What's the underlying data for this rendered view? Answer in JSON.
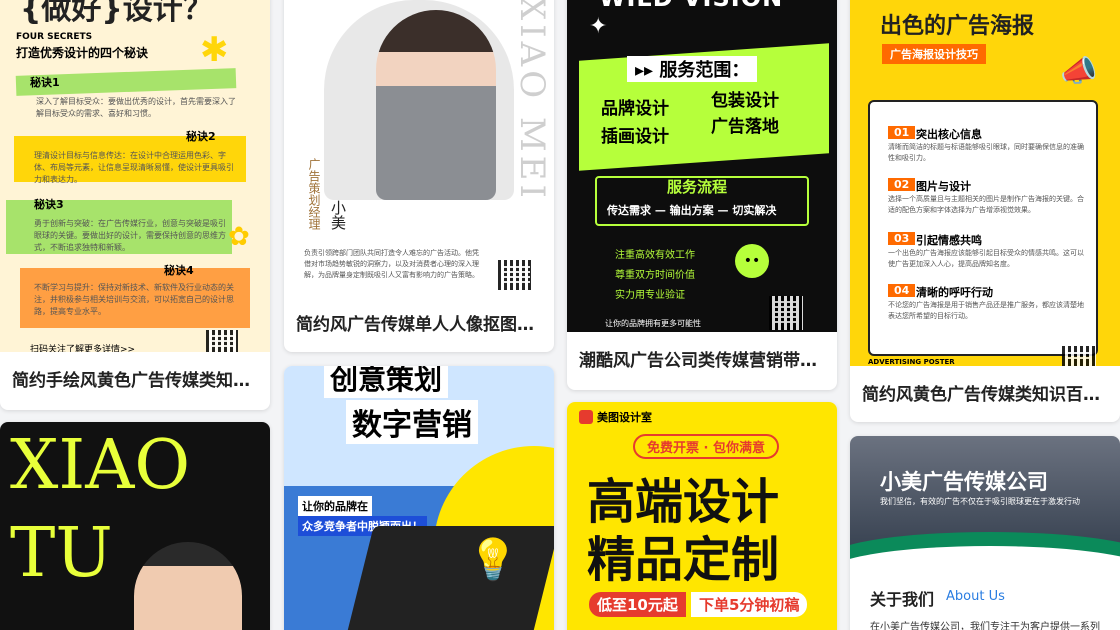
{
  "colors": {
    "yellow": "#ffd60a",
    "lime": "#b6ff3b",
    "orange": "#ff8a00",
    "green": "#0b8a5a",
    "blue": "#2a7de1"
  },
  "cards": {
    "c1": {
      "caption": "简约手绘风黄色广告传媒类知识百科小红书配图",
      "head": "{做好}设计？",
      "eng": "FOUR SECRETS",
      "sub": "打造优秀设计的四个秘诀",
      "tips": [
        {
          "label": "秘诀1",
          "text": "深入了解目标受众：要做出优秀的设计，首先需要深入了解目标受众的需求、喜好和习惯。"
        },
        {
          "label": "秘诀2",
          "text": "理清设计目标与信息传达：在设计中合理运用色彩、字体、布局等元素，让信息呈现清晰易懂，使设计更具吸引力和表达力。"
        },
        {
          "label": "秘诀3",
          "text": "勇于创新与突破：在广告传媒行业，创意与突破是吸引眼球的关键。要做出好的设计，需要保持创意的思维方式，不断追求独特和新颖。"
        },
        {
          "label": "秘诀4",
          "text": "不断学习与提升：保持对新技术、新软件及行业动态的关注，并积极参与相关培训与交流，可以拓宽自己的设计思路，提高专业水平。"
        }
      ],
      "footer": "扫码关注了解更多详情>>"
    },
    "c2": {
      "caption": "简约风广告传媒单人人像抠图海报",
      "vertical": "XIAO MEI",
      "role": "广告策划经理",
      "name": "小美",
      "bio": "负责引领跨部门团队共同打造令人难忘的广告活动。他凭借对市场趋势敏锐的洞察力，以及对消费者心理的深入理解，为品牌量身定制既吸引人又富有影响力的广告策略。"
    },
    "c3": {
      "caption": "潮酷风广告公司类传媒营销带货小红书配图",
      "head": "WILD VISION",
      "scope_title": "服务范围：",
      "services": [
        "品牌设计",
        "包装设计",
        "插画设计",
        "广告落地"
      ],
      "flow_title": "服务流程",
      "flow": "传达需求 — 输出方案 — 切实解决",
      "bullets": [
        "注重高效有效工作",
        "尊重双方时间价值",
        "实力用专业验证"
      ],
      "footer": "让你的品牌拥有更多可能性"
    },
    "c4": {
      "caption": "简约风黄色广告传媒类知识百科小红书配图",
      "head": "出色的广告海报",
      "tag": "广告海报设计技巧",
      "items": [
        {
          "no": "01",
          "title": "突出核心信息",
          "text": "清晰而简洁的标题与标语能够吸引眼球，同时要确保信息的准确性和吸引力。"
        },
        {
          "no": "02",
          "title": "图片与设计",
          "text": "选择一个高质量且与主题相关的图片是制作广告海报的关键。合适的配色方案和字体选择为广告增添视觉效果。"
        },
        {
          "no": "03",
          "title": "引起情感共鸣",
          "text": "一个出色的广告海报应该能够引起目标受众的情感共鸣。这可以使广告更加深入人心，提高品牌知名度。"
        },
        {
          "no": "04",
          "title": "清晰的呼吁行动",
          "text": "不论您的广告海报是用于销售产品还是推广服务，都应该清楚地表达您所希望的目标行动。"
        }
      ],
      "footer": "ADVERTISING POSTER"
    },
    "c5": {
      "line1": "XIAO",
      "line2": "TU"
    },
    "c6": {
      "head": "创意策划",
      "head2": "数字营销",
      "bubble1": "让你的品牌在",
      "bubble2": "众多竞争者中脱颖而出！"
    },
    "c7": {
      "logo": "美图设计室",
      "pill": "免费开票 · 包你满意",
      "big1": "高端设计",
      "big2": "精品定制",
      "price": "低至10元起",
      "promise": "下单5分钟初稿"
    },
    "c8": {
      "head": "小美广告传媒公司",
      "sub": "我们坚信，有效的广告不仅在于吸引眼球更在于激发行动",
      "about": "关于我们",
      "about_en": "About Us",
      "body": "在小美广告传媒公司，我们专注于为客户提供一系列"
    }
  }
}
